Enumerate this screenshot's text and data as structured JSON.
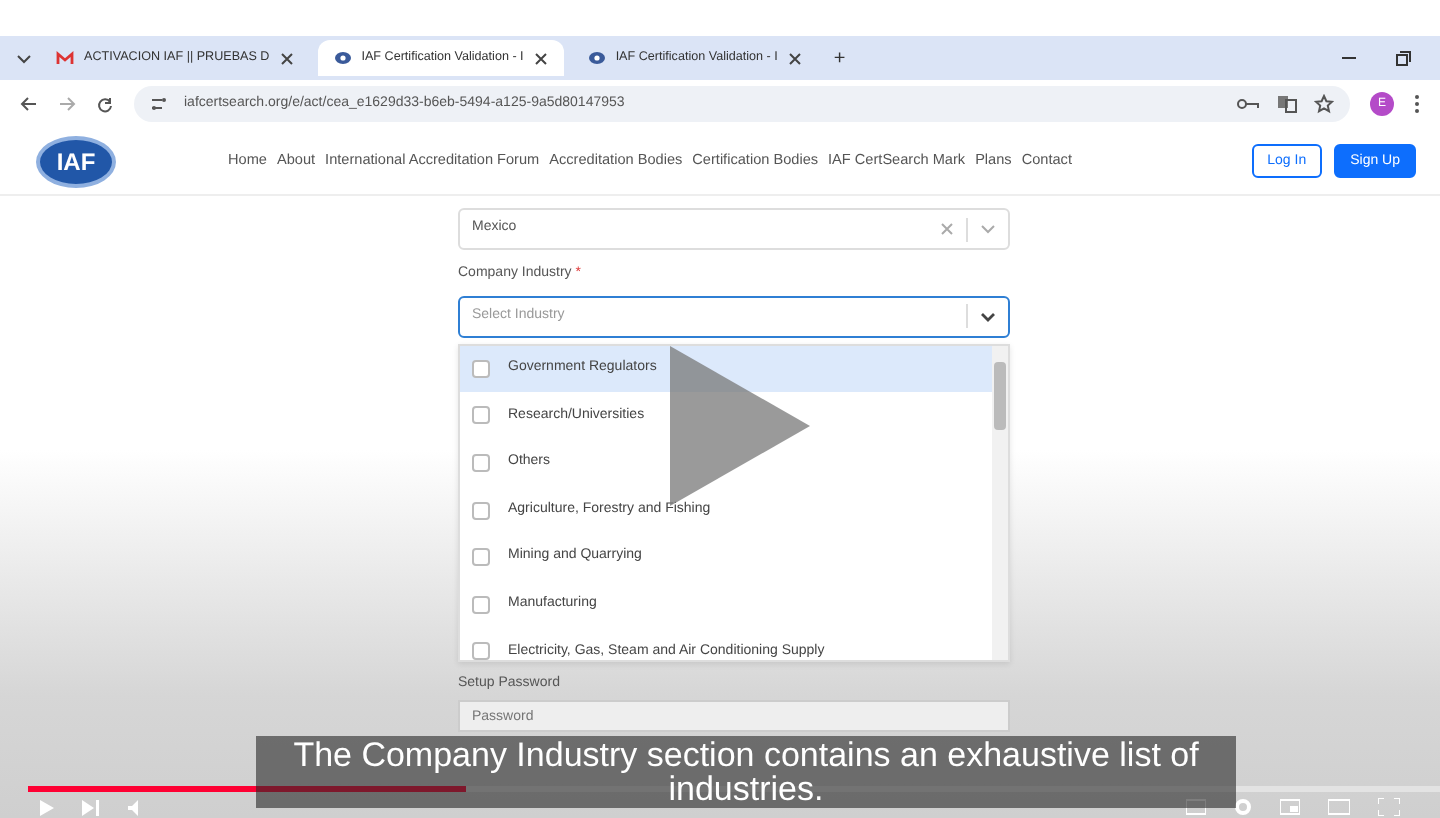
{
  "browser": {
    "tabs": [
      {
        "title": "ACTIVACION IAF || PRUEBAS D",
        "kind": "mail",
        "selected": false
      },
      {
        "title": "IAF Certification Validation - I",
        "kind": "site",
        "selected": true
      },
      {
        "title": "IAF Certification Validation - I",
        "kind": "site",
        "selected": false
      }
    ],
    "new_tab": "+",
    "url": "iafcertsearch.org/e/act/cea_e1629d33-b6eb-5494-a125-9a5d80147953",
    "profile_initial": "E"
  },
  "site": {
    "logo": "IAF",
    "nav": [
      "Home",
      "About",
      "International Accreditation Forum",
      "Accreditation Bodies",
      "Certification Bodies",
      "IAF CertSearch Mark",
      "Plans",
      "Contact"
    ],
    "login": "Log In",
    "signup": "Sign Up"
  },
  "form": {
    "country_value": "Mexico",
    "industry_label": "Company Industry",
    "required_mark": "*",
    "industry_placeholder": "Select Industry",
    "options": [
      {
        "label": "Government Regulators",
        "checked": false,
        "highlighted": true
      },
      {
        "label": "Research/Universities",
        "checked": false,
        "highlighted": false
      },
      {
        "label": "Others",
        "checked": false,
        "highlighted": false
      },
      {
        "label": "Agriculture, Forestry and Fishing",
        "checked": false,
        "highlighted": false
      },
      {
        "label": "Mining and Quarrying",
        "checked": false,
        "highlighted": false
      },
      {
        "label": "Manufacturing",
        "checked": false,
        "highlighted": false
      },
      {
        "label": "Electricity, Gas, Steam and Air Conditioning Supply",
        "checked": false,
        "highlighted": false
      }
    ],
    "password_label": "Setup Password",
    "password_placeholder": "Password"
  },
  "player": {
    "caption": "The Company Industry section contains an exhaustive list of industries.",
    "progress": {
      "level": 0.31
    }
  }
}
